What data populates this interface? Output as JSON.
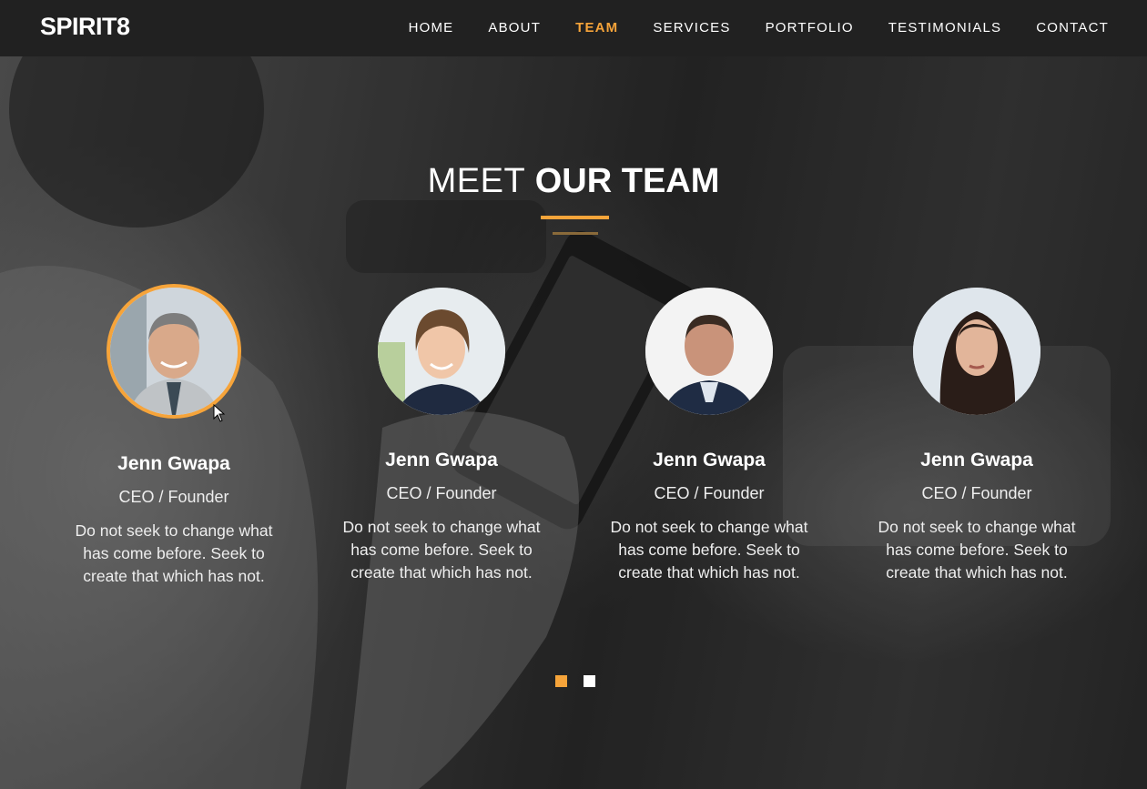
{
  "brand": "SPIRIT8",
  "nav": [
    "HOME",
    "ABOUT",
    "TEAM",
    "SERVICES",
    "PORTFOLIO",
    "TESTIMONIALS",
    "CONTACT"
  ],
  "active_nav": "TEAM",
  "section": {
    "title_light": "MEET",
    "title_bold": "OUR TEAM"
  },
  "team": [
    {
      "name": "Jenn Gwapa",
      "role": "CEO / Founder",
      "quote": "Do not seek to change what has come before. Seek to create that which has not.",
      "photo_icon": "man-gray-hair-photo"
    },
    {
      "name": "Jenn Gwapa",
      "role": "CEO / Founder",
      "quote": "Do not seek to change what has come before. Seek to create that which has not.",
      "photo_icon": "woman-smiling-photo"
    },
    {
      "name": "Jenn Gwapa",
      "role": "CEO / Founder",
      "quote": "Do not seek to change what has come before. Seek to create that which has not.",
      "photo_icon": "man-suit-photo"
    },
    {
      "name": "Jenn Gwapa",
      "role": "CEO / Founder",
      "quote": "Do not seek to change what has come before. Seek to create that which has not.",
      "photo_icon": "woman-dark-hair-photo"
    }
  ],
  "pagination": {
    "pages": 2,
    "active": 1
  },
  "colors": {
    "accent": "#f6a43a",
    "navbar": "#212121",
    "text": "#ffffff"
  }
}
